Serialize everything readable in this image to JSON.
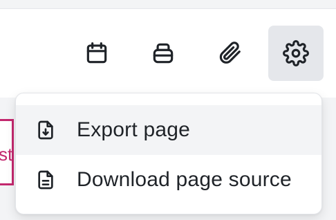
{
  "toolbar": {
    "buttons": [
      {
        "icon": "calendar-icon",
        "active": false
      },
      {
        "icon": "print-icon",
        "active": false
      },
      {
        "icon": "paperclip-icon",
        "active": false
      },
      {
        "icon": "gear-icon",
        "active": true
      }
    ]
  },
  "background": {
    "tab_text_fragment": "st",
    "accent_color": "#c3286e"
  },
  "menu": {
    "items": [
      {
        "label": "Export page",
        "icon": "file-download-icon",
        "highlighted": true
      },
      {
        "label": "Download page source",
        "icon": "file-text-icon",
        "highlighted": false
      }
    ]
  }
}
